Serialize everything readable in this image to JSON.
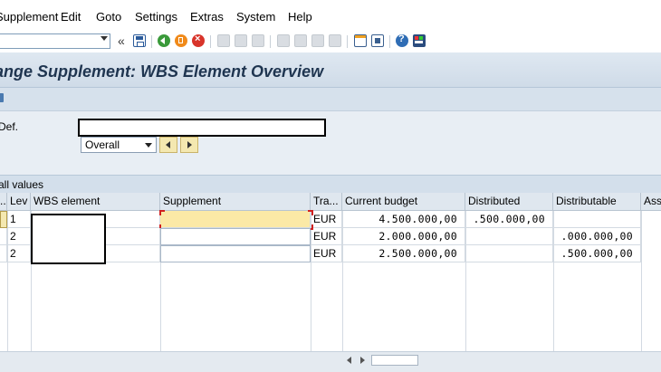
{
  "menu": [
    "Supplement",
    "Edit",
    "Goto",
    "Settings",
    "Extras",
    "System",
    "Help"
  ],
  "toolbar": {
    "command_value": "",
    "history_chevron": "«",
    "icons": [
      "save-icon",
      "back-icon",
      "exit-icon",
      "cancel-icon",
      "print-icon",
      "find-icon",
      "find-next-icon",
      "first-page-icon",
      "previous-page-icon",
      "next-page-icon",
      "last-page-icon",
      "create-session-icon",
      "shortcut-icon",
      "help-icon",
      "customize-layout-icon"
    ]
  },
  "title": "ange Supplement: WBS Element Overview",
  "header": {
    "def_label": "Def.",
    "def_value": "",
    "period_value": "Overall"
  },
  "grid": {
    "title": "all values",
    "columns": [
      "..",
      "Lev",
      "WBS element",
      "Supplement",
      "Tra...",
      "Current budget",
      "Distributed",
      "Distributable",
      "Ass"
    ],
    "rows": [
      {
        "sel": "",
        "lev": "1",
        "wbs": "",
        "supplement": "",
        "currency": "EUR",
        "current_budget": "4.500.000,00",
        "distributed": ".500.000,00",
        "distributable": ""
      },
      {
        "sel": "",
        "lev": "2",
        "wbs": "",
        "supplement": "",
        "currency": "EUR",
        "current_budget": "2.000.000,00",
        "distributed": "",
        "distributable": ".000.000,00"
      },
      {
        "sel": "",
        "lev": "2",
        "wbs": "",
        "supplement": "",
        "currency": "EUR",
        "current_budget": "2.500.000,00",
        "distributed": "",
        "distributable": ".500.000,00"
      }
    ]
  },
  "colors": {
    "title": "#1f3550",
    "focus_cell": "#fbe9a6",
    "nav_button": "#f4e8b0"
  }
}
